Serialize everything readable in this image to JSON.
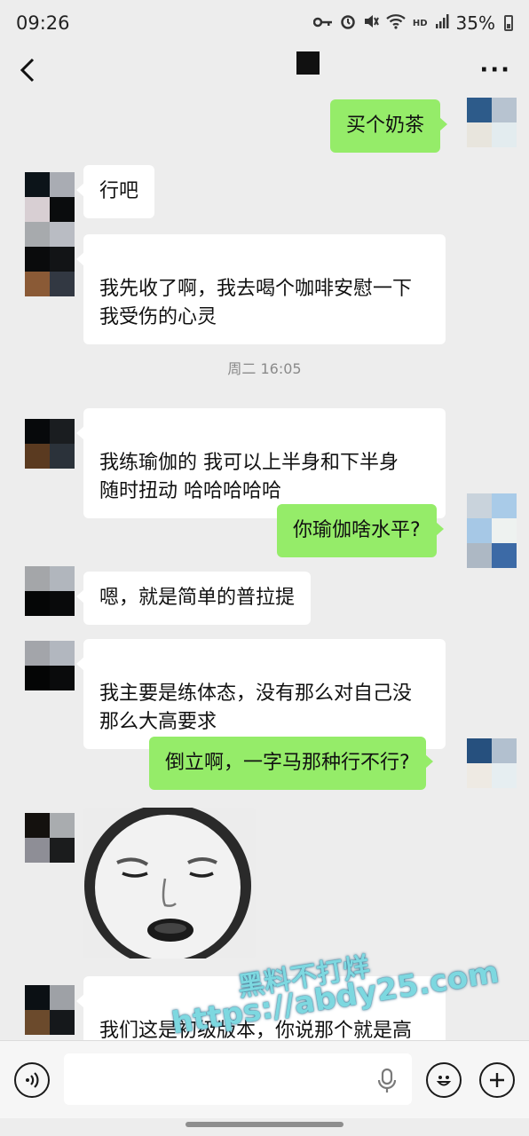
{
  "status_bar": {
    "time": "09:26",
    "battery_text": "35%",
    "icons": [
      "key-icon",
      "alarm-icon",
      "mute-icon",
      "wifi-icon",
      "hd-icon",
      "signal-icon",
      "battery-icon"
    ],
    "hd_label": "HD"
  },
  "header": {
    "back_icon": "chevron-left-icon",
    "more_label": "···"
  },
  "messages": [
    {
      "side": "out",
      "text": "买个奶茶"
    },
    {
      "side": "in",
      "text": "行吧"
    },
    {
      "side": "in",
      "text": "我先收了啊，我去喝个咖啡安慰一下\n我受伤的心灵"
    },
    {
      "side": "in",
      "text": "我练瑜伽的 我可以上半身和下半身\n随时扭动 哈哈哈哈哈"
    },
    {
      "side": "out",
      "text": "你瑜伽啥水平?"
    },
    {
      "side": "in",
      "text": "嗯，就是简单的普拉提"
    },
    {
      "side": "in",
      "text": "我主要是练体态，没有那么对自己没\n那么大高要求"
    },
    {
      "side": "out",
      "text": "倒立啊，一字马那种行不行?"
    },
    {
      "side": "in",
      "type": "sticker",
      "text": ""
    },
    {
      "side": "in",
      "text": "我们这是初级版本，你说那个就是高\n级版本，那直接那是瑜伽老师干的事"
    }
  ],
  "timestamp": "周二 16:05",
  "watermark": {
    "line1": "黑料不打烊",
    "line2": "https://abdy25.com"
  },
  "input_bar": {
    "value": "",
    "placeholder": "",
    "left_icon": "voice-icon",
    "mic_icon": "mic-icon",
    "emoji_icon": "emoji-icon",
    "plus_icon": "plus-icon"
  },
  "colors": {
    "background": "#ededed",
    "incoming_bubble": "#ffffff",
    "outgoing_bubble": "#95ec69",
    "timestamp": "#8a8a8a"
  }
}
